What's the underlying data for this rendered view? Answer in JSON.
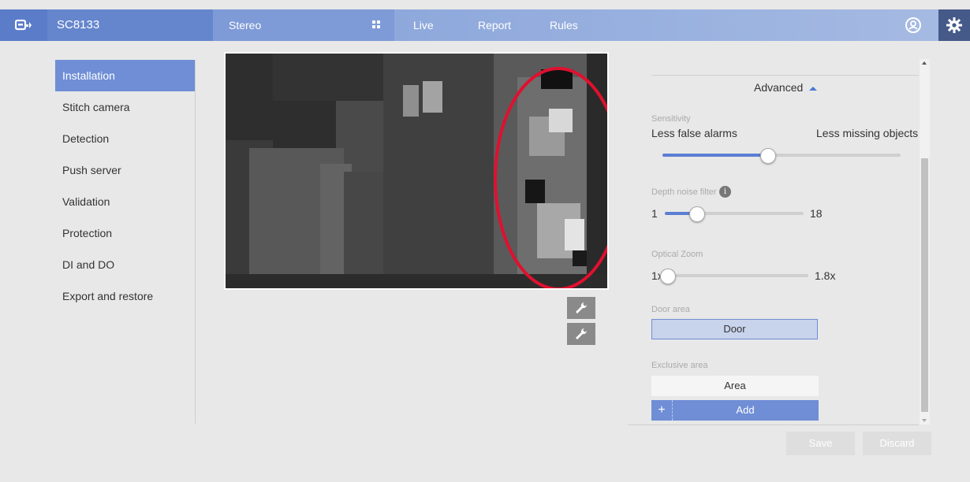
{
  "header": {
    "model": "SC8133",
    "view_mode": "Stereo",
    "nav": [
      "Live",
      "Report",
      "Rules"
    ]
  },
  "sidebar": {
    "items": [
      {
        "label": "Installation",
        "active": true
      },
      {
        "label": "Stitch camera"
      },
      {
        "label": "Detection"
      },
      {
        "label": "Push server"
      },
      {
        "label": "Validation"
      },
      {
        "label": "Protection"
      },
      {
        "label": "DI and DO"
      },
      {
        "label": "Export and restore"
      }
    ]
  },
  "settings": {
    "advanced_label": "Advanced",
    "sensitivity": {
      "label": "Sensitivity",
      "left_label": "Less false alarms",
      "right_label": "Less missing objects",
      "level": 0.44
    },
    "depth_noise": {
      "label": "Depth noise filter",
      "min": "1",
      "max": "18",
      "value_fraction": 0.23
    },
    "optical_zoom": {
      "label": "Optical Zoom",
      "min": "1x",
      "max": "1.8x",
      "value_fraction": 0.0
    },
    "door_area": {
      "label": "Door area",
      "button": "Door"
    },
    "exclusive_area": {
      "label": "Exclusive area",
      "area_button": "Area",
      "add_button": "Add"
    }
  },
  "footer": {
    "save": "Save",
    "discard": "Discard"
  },
  "colors": {
    "accent": "#6f8ed6",
    "annotation": "#e0102f"
  }
}
